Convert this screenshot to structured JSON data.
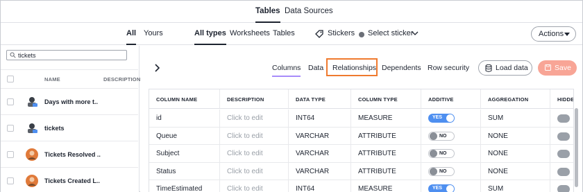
{
  "top_tabs": [
    {
      "label": "Tables",
      "active": true
    },
    {
      "label": "Data Sources",
      "active": false
    }
  ],
  "filters": {
    "scope": [
      {
        "label": "All",
        "active": true
      },
      {
        "label": "Yours",
        "active": false
      }
    ],
    "types": [
      {
        "label": "All types",
        "active": true
      },
      {
        "label": "Worksheets",
        "active": false
      },
      {
        "label": "Tables",
        "active": false
      }
    ],
    "stickers_label": "Stickers",
    "select_sticker_label": "Select sticker",
    "actions_label": "Actions"
  },
  "sidebar": {
    "search_value": "tickets",
    "col_name": "NAME",
    "col_description": "DESCRIPTION",
    "items": [
      {
        "name": "Days with more t.."
      },
      {
        "name": "tickets"
      },
      {
        "name": "Tickets Resolved .."
      },
      {
        "name": "Tickets Created L.."
      }
    ]
  },
  "detail_tabs": [
    {
      "label": "Columns",
      "active": true
    },
    {
      "label": "Data",
      "active": false
    },
    {
      "label": "Relationships",
      "active": false,
      "highlighted": true
    },
    {
      "label": "Dependents",
      "active": false
    },
    {
      "label": "Row security",
      "active": false
    }
  ],
  "buttons": {
    "load_data": "Load data",
    "save": "Save"
  },
  "grid": {
    "headers": [
      "COLUMN NAME",
      "DESCRIPTION",
      "DATA TYPE",
      "COLUMN TYPE",
      "ADDITIVE",
      "AGGREGATION",
      "HIDDE"
    ],
    "rows": [
      {
        "name": "id",
        "description": "Click to edit",
        "data_type": "INT64",
        "column_type": "MEASURE",
        "additive": "YES",
        "aggregation": "SUM"
      },
      {
        "name": "Queue",
        "description": "Click to edit",
        "data_type": "VARCHAR",
        "column_type": "ATTRIBUTE",
        "additive": "NO",
        "aggregation": "NONE"
      },
      {
        "name": "Subject",
        "description": "Click to edit",
        "data_type": "VARCHAR",
        "column_type": "ATTRIBUTE",
        "additive": "NO",
        "aggregation": "NONE"
      },
      {
        "name": "Status",
        "description": "Click to edit",
        "data_type": "VARCHAR",
        "column_type": "ATTRIBUTE",
        "additive": "NO",
        "aggregation": "NONE"
      },
      {
        "name": "TimeEstimated",
        "description": "Click to edit",
        "data_type": "INT64",
        "column_type": "MEASURE",
        "additive": "YES",
        "aggregation": "SUM"
      }
    ]
  },
  "colors": {
    "accent_purple": "#a78bfa",
    "toggle_blue": "#4e8ff0",
    "highlight_orange": "#ef7a2e",
    "save_disabled": "#f8a596"
  },
  "icons": {
    "sticker": "tag-icon",
    "chevron": "chevron-down-icon",
    "expand": "chevron-right-icon",
    "search": "search-icon",
    "database": "database-icon",
    "save": "floppy-disk-icon"
  }
}
